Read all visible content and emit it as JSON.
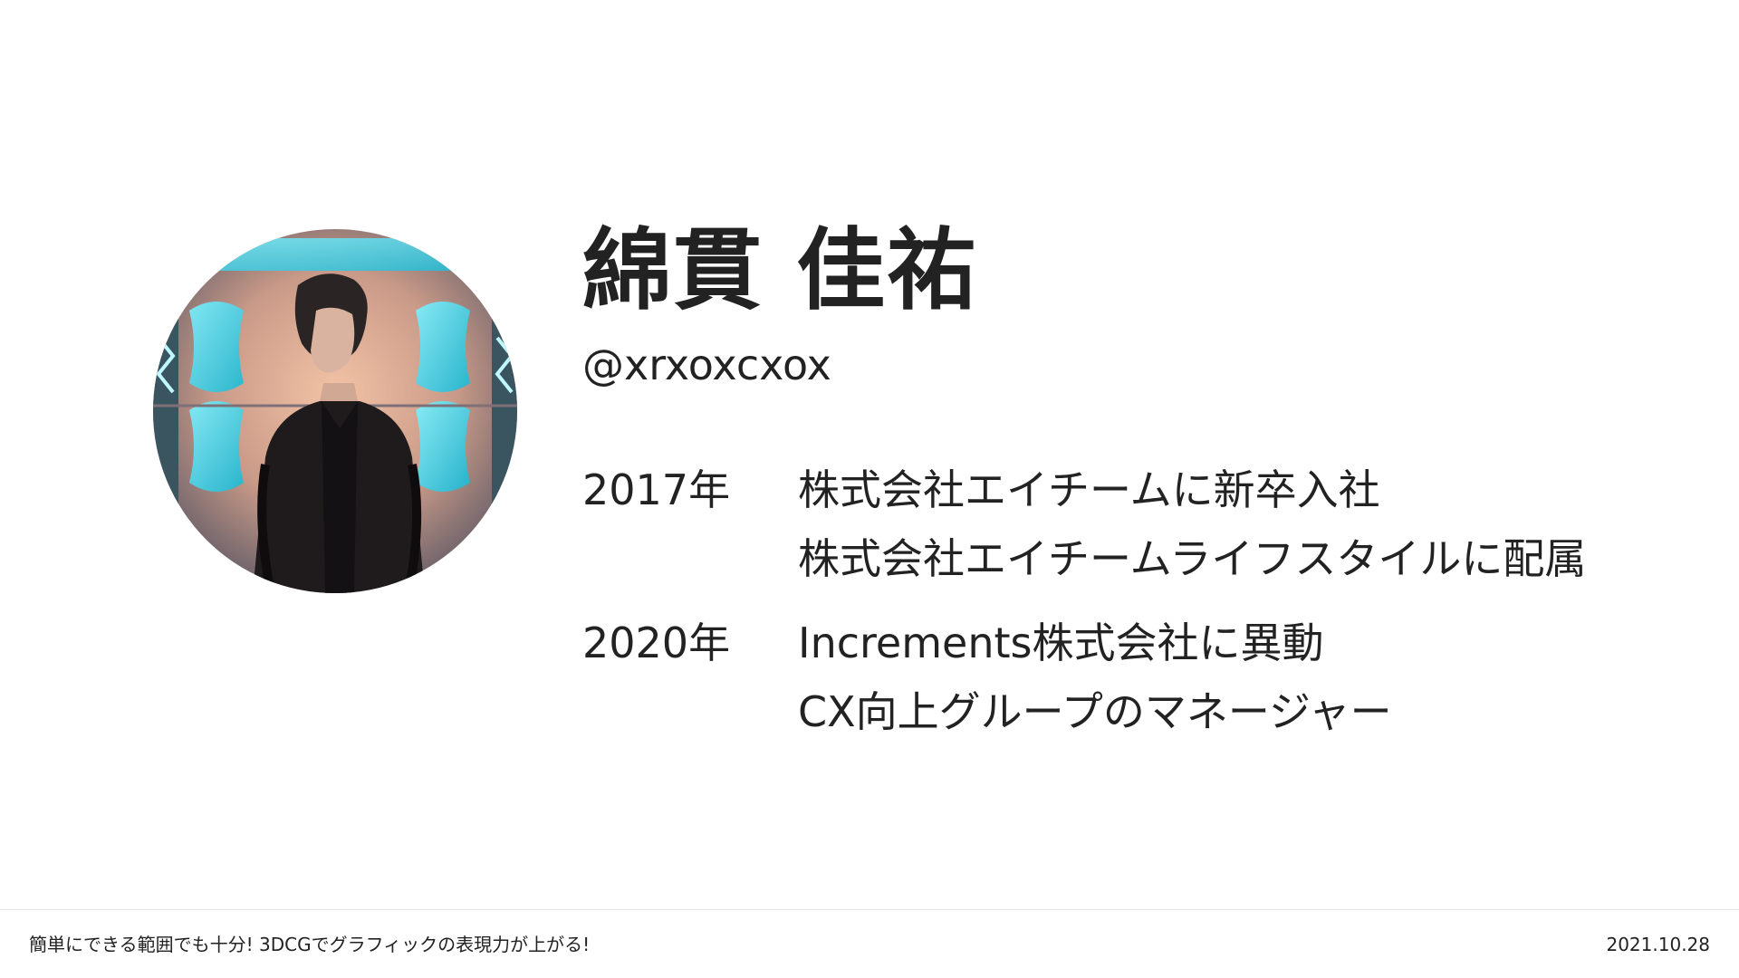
{
  "profile": {
    "name": "綿貫 佳祐",
    "handle": "@xrxoxcxox",
    "photo_icon": "profile-photo"
  },
  "career": [
    {
      "year": "2017年",
      "events": [
        "株式会社エイチームに新卒入社",
        "株式会社エイチームライフスタイルに配属"
      ]
    },
    {
      "year": "2020年",
      "events": [
        "Increments株式会社に異動",
        "CX向上グループのマネージャー"
      ]
    }
  ],
  "footer": {
    "title": "簡単にできる範囲でも十分! 3DCGでグラフィックの表現力が上がる!",
    "date": "2021.10.28"
  },
  "colors": {
    "text": "#222222",
    "background": "#ffffff",
    "photo_accent": "#39d3e6"
  }
}
